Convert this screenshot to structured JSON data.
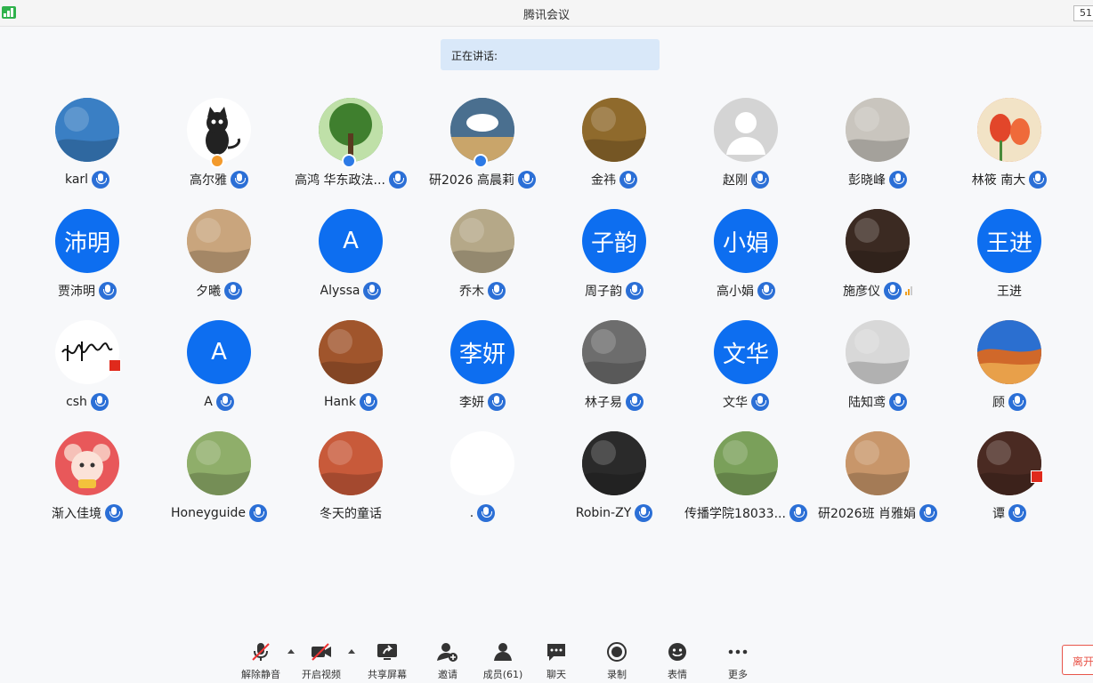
{
  "window": {
    "title": "腾讯会议",
    "timer": "51"
  },
  "banner": {
    "speaking": "正在讲话:"
  },
  "participants": [
    {
      "name": "karl",
      "avatar": "photo-lake",
      "bg": "#3a7fc4"
    },
    {
      "name": "高尔雅",
      "avatar": "photo-cat",
      "bg": "#ffffff",
      "host_badge": true
    },
    {
      "name": "高鸿 华东政法...",
      "avatar": "photo-tree",
      "bg": "#4e8a3a",
      "host_badge": true
    },
    {
      "name": "研2026  高晨莉",
      "avatar": "photo-cloud",
      "bg": "#5b7b99",
      "host_badge": true
    },
    {
      "name": "金祎",
      "avatar": "photo-autumn",
      "bg": "#8f6a2c"
    },
    {
      "name": "赵刚",
      "avatar": "default-avatar",
      "bg": "#d4d4d4"
    },
    {
      "name": "彭晓峰",
      "avatar": "photo-sketch",
      "bg": "#c9c5be"
    },
    {
      "name": "林筱  南大",
      "avatar": "photo-tulips",
      "bg": "#e06a3a"
    },
    {
      "name": "贾沛明",
      "avatar_text": "沛明",
      "bg": "#0d6ef0"
    },
    {
      "name": "夕曦",
      "avatar": "photo-kittens",
      "bg": "#c9a57d"
    },
    {
      "name": "Alyssa",
      "avatar_text": "A",
      "bg": "#0d6ef0"
    },
    {
      "name": "乔木",
      "avatar": "photo-sea",
      "bg": "#b5a888"
    },
    {
      "name": "周子韵",
      "avatar_text": "子韵",
      "bg": "#0d6ef0"
    },
    {
      "name": "高小娟",
      "avatar_text": "小娟",
      "bg": "#0d6ef0"
    },
    {
      "name": "施彦仪",
      "avatar": "photo-animal",
      "bg": "#3b2a22",
      "level": true
    },
    {
      "name": "王进",
      "avatar_text": "王进",
      "bg": "#0d6ef0",
      "no_mic": true
    },
    {
      "name": "csh",
      "avatar": "photo-signature",
      "bg": "#ffffff",
      "flag": true
    },
    {
      "name": "A",
      "avatar_text": "A",
      "bg": "#0d6ef0"
    },
    {
      "name": "Hank",
      "avatar": "photo-pipes",
      "bg": "#a0552c"
    },
    {
      "name": "李妍",
      "avatar_text": "李妍",
      "bg": "#0d6ef0"
    },
    {
      "name": "林子易",
      "avatar": "photo-crowd",
      "bg": "#6d6d6d"
    },
    {
      "name": "文华",
      "avatar_text": "文华",
      "bg": "#0d6ef0"
    },
    {
      "name": "陆知鸢",
      "avatar": "photo-portrait",
      "bg": "#d8d8d8"
    },
    {
      "name": "顾",
      "avatar": "photo-desert",
      "bg": "#c85a1e"
    },
    {
      "name": "渐入佳境",
      "avatar": "photo-cartoon-mouse",
      "bg": "#e8585a"
    },
    {
      "name": "Honeyguide",
      "avatar": "photo-flower",
      "bg": "#8fae6a"
    },
    {
      "name": "冬天的童话",
      "avatar": "photo-rose",
      "bg": "#c85a3a",
      "no_mic": true
    },
    {
      "name": ".",
      "avatar": "blank-avatar",
      "bg": "#ffffff"
    },
    {
      "name": "Robin-ZY",
      "avatar": "photo-smoke",
      "bg": "#2a2a2a"
    },
    {
      "name": "传播学院18033...",
      "avatar": "photo-woman-field",
      "bg": "#7aa05a"
    },
    {
      "name": "研2026班 肖雅娟",
      "avatar": "photo-woman-dog",
      "bg": "#c8966a"
    },
    {
      "name": "谭",
      "avatar": "photo-horse-flag",
      "bg": "#4a2a22",
      "flag": true
    }
  ],
  "toolbar": [
    {
      "key": "unmute",
      "label": "解除静音",
      "icon": "mic-muted-icon",
      "caret": true
    },
    {
      "key": "video",
      "label": "开启视频",
      "icon": "camera-off-icon",
      "caret": true
    },
    {
      "key": "share",
      "label": "共享屏幕",
      "icon": "share-screen-icon"
    },
    {
      "key": "invite",
      "label": "邀请",
      "icon": "invite-icon"
    },
    {
      "key": "members",
      "label": "成员(61)",
      "icon": "members-icon"
    },
    {
      "key": "chat",
      "label": "聊天",
      "icon": "chat-icon"
    },
    {
      "key": "record",
      "label": "录制",
      "icon": "record-icon"
    },
    {
      "key": "emoji",
      "label": "表情",
      "icon": "emoji-icon"
    },
    {
      "key": "more",
      "label": "更多",
      "icon": "more-icon"
    }
  ],
  "leave": {
    "label": "离开"
  },
  "colors": {
    "accent": "#0d6ef0",
    "mic": "#2b6fd6",
    "leave": "#e8554a"
  }
}
